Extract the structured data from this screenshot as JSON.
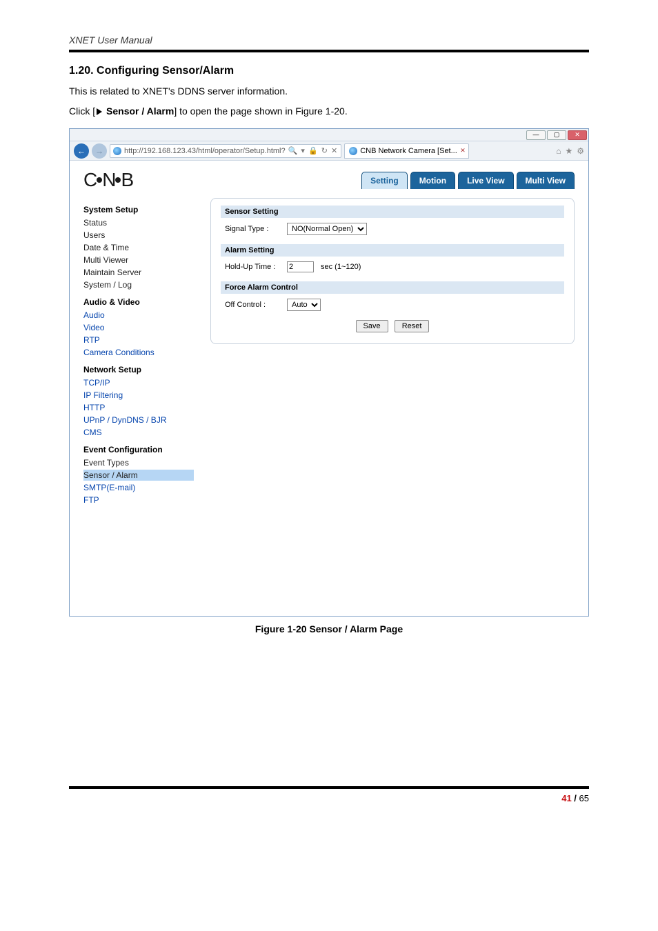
{
  "doc": {
    "header": "XNET User Manual",
    "section_number": "1.20. Configuring Sensor/Alarm",
    "intro": "This is related to XNET's DDNS server information.",
    "click_pre": "Click [",
    "click_bold": "Sensor / Alarm",
    "click_post": "] to open the page shown in Figure 1-20.",
    "fig_caption": "Figure 1-20 Sensor / Alarm Page",
    "page_current": "41",
    "page_sep": " / ",
    "page_total": "65"
  },
  "browser": {
    "url": "http://192.168.123.43/html/operator/Setup.html?",
    "url_icons": "🔍 ▾  🔒 ↻ ✕",
    "tab_title": "CNB Network Camera [Set...",
    "win": {
      "min": "—",
      "max": "▢",
      "close": "✕"
    },
    "tool_icons": {
      "home": "⌂",
      "star": "★",
      "gear": "⚙"
    }
  },
  "app": {
    "logo_c": "C",
    "logo_n": "N",
    "logo_b": "B",
    "tabs": {
      "setting": "Setting",
      "motion": "Motion",
      "live": "Live View",
      "multi": "Multi View"
    },
    "sidebar": {
      "g1": {
        "title": "System Setup",
        "items": [
          "Status",
          "Users",
          "Date & Time",
          "Multi Viewer",
          "Maintain Server",
          "System / Log"
        ]
      },
      "g2": {
        "title": "Audio & Video",
        "items": [
          "Audio",
          "Video",
          "RTP",
          "Camera Conditions"
        ]
      },
      "g3": {
        "title": "Network Setup",
        "items": [
          "TCP/IP",
          "IP Filtering",
          "HTTP",
          "UPnP / DynDNS / BJR",
          "CMS"
        ]
      },
      "g4": {
        "title": "Event Configuration",
        "items": [
          "Event Types",
          "Sensor / Alarm",
          "SMTP(E-mail)",
          "FTP"
        ]
      }
    },
    "form": {
      "sensor_hdr": "Sensor Setting",
      "signal_lbl": "Signal Type :",
      "signal_val": "NO(Normal Open)",
      "alarm_hdr": "Alarm Setting",
      "hold_lbl": "Hold-Up Time :",
      "hold_val": "2",
      "hold_unit": "sec (1~120)",
      "force_hdr": "Force Alarm Control",
      "off_lbl": "Off Control :",
      "off_val": "Auto",
      "save": "Save",
      "reset": "Reset"
    }
  }
}
